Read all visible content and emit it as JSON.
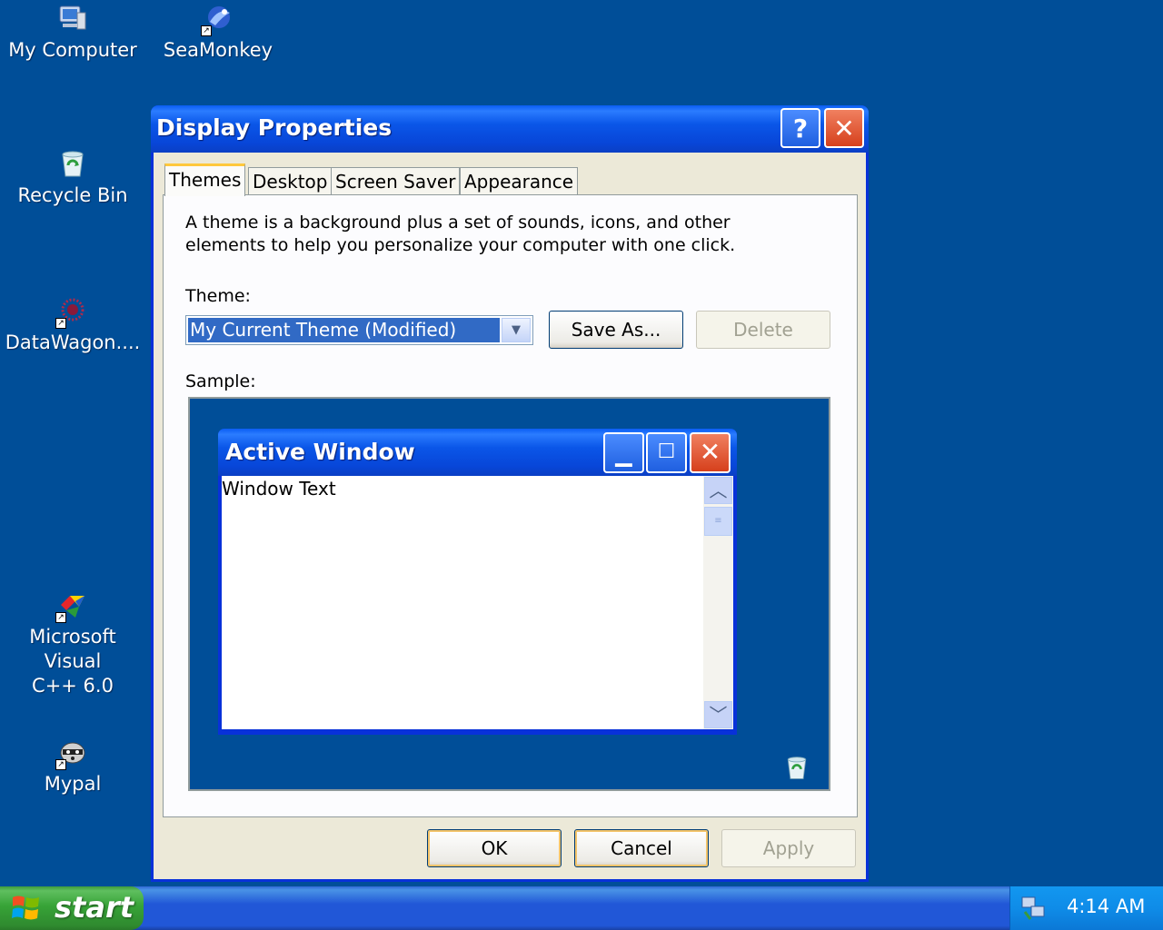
{
  "desktop_icons": {
    "my_computer": "My Computer",
    "seamonkey": "SeaMonkey",
    "recycle_bin": "Recycle Bin",
    "datawagon": "DataWagon....",
    "msvc_line1": "Microsoft Visual",
    "msvc_line2": "C++ 6.0",
    "mypal": "Mypal"
  },
  "window": {
    "title": "Display Properties",
    "help_label": "?",
    "close_label": "✕"
  },
  "tabs": [
    {
      "label": "Themes",
      "active": true
    },
    {
      "label": "Desktop",
      "active": false
    },
    {
      "label": "Screen Saver",
      "active": false
    },
    {
      "label": "Appearance",
      "active": false
    }
  ],
  "themes_panel": {
    "description_line1": "A theme is a background plus a set of sounds, icons, and other",
    "description_line2": "elements to help you personalize your computer with one click.",
    "theme_label": "Theme:",
    "theme_value": "My Current Theme (Modified)",
    "save_as": "Save As...",
    "delete": "Delete",
    "sample_label": "Sample:"
  },
  "sample": {
    "window_title": "Active Window",
    "window_text": "Window Text"
  },
  "buttons": {
    "ok": "OK",
    "cancel": "Cancel",
    "apply": "Apply"
  },
  "taskbar": {
    "start_label": "start",
    "clock": "4:14 AM"
  }
}
